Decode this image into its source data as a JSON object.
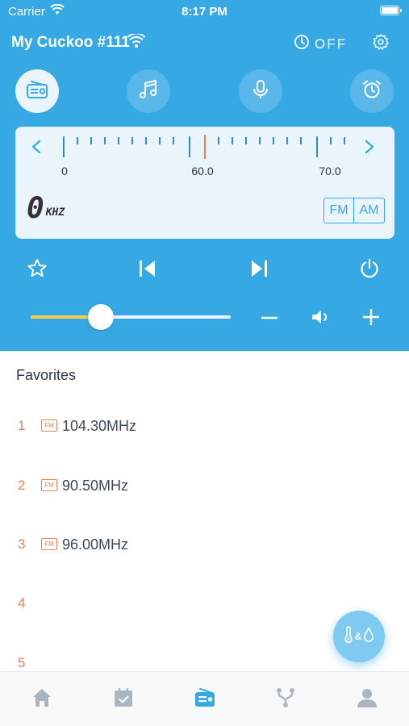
{
  "status_bar": {
    "carrier": "Carrier",
    "time": "8:17 PM"
  },
  "header": {
    "device_name": "My Cuckoo #111",
    "timer_label": "OFF"
  },
  "modes": [
    {
      "name": "radio-icon",
      "active": true
    },
    {
      "name": "music-icon",
      "active": false
    },
    {
      "name": "microphone-icon",
      "active": false
    },
    {
      "name": "alarm-clock-icon",
      "active": false
    }
  ],
  "tuner": {
    "tick_labels": [
      "0",
      "60.0",
      "70.0"
    ],
    "frequency_digit": "0",
    "frequency_unit": "KHZ",
    "bands": [
      "FM",
      "AM"
    ]
  },
  "volume": {
    "level": 0.35
  },
  "favorites": {
    "title": "Favorites",
    "items": [
      {
        "num": "1",
        "badge": "FM",
        "freq": "104.30MHz"
      },
      {
        "num": "2",
        "badge": "FM",
        "freq": "90.50MHz"
      },
      {
        "num": "3",
        "badge": "FM",
        "freq": "96.00MHz"
      },
      {
        "num": "4",
        "badge": "",
        "freq": ""
      },
      {
        "num": "5",
        "badge": "",
        "freq": ""
      }
    ]
  },
  "fab": {
    "label": "&"
  },
  "colors": {
    "accent": "#36a8e3",
    "favorite_number": "#e8825a",
    "volume_fill": "#f6cf4e",
    "needle": "#e8825a"
  },
  "tabs": [
    {
      "name": "home-icon",
      "active": false
    },
    {
      "name": "calendar-icon",
      "active": false
    },
    {
      "name": "radio-icon",
      "active": true
    },
    {
      "name": "branch-icon",
      "active": false
    },
    {
      "name": "user-icon",
      "active": false
    }
  ]
}
